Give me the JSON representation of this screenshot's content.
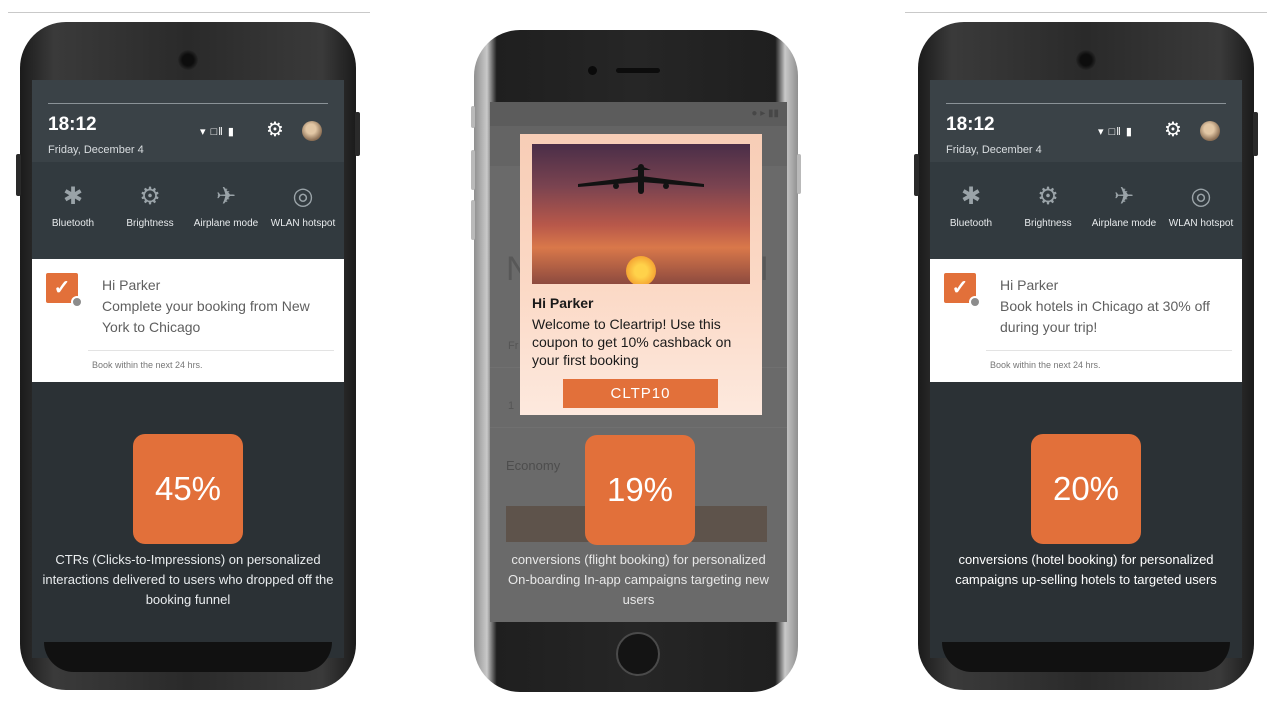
{
  "android_status": {
    "time": "18:12",
    "date": "Friday, December 4",
    "signal_text": "▾ □‖ ▮"
  },
  "quick_settings": [
    {
      "label": "Bluetooth",
      "icon": "✱"
    },
    {
      "label": "Brightness",
      "icon": "⚙"
    },
    {
      "label": "Airplane mode",
      "icon": "✈"
    },
    {
      "label": "WLAN hotspot",
      "icon": "◎"
    }
  ],
  "phones": [
    {
      "notification": {
        "title": "Hi Parker",
        "body": "Complete your booking from New York to Chicago",
        "footer": "Book within the next 24 hrs."
      },
      "stat": "45%",
      "caption": "CTRs (Clicks-to-Impressions) on personalized interactions delivered to users who dropped off the booking funnel"
    },
    {
      "coupon": {
        "title": "Hi Parker",
        "body": "Welcome to Cleartrip! Use this coupon to get 10% cashback on your first booking",
        "code": "CLTP10"
      },
      "background": {
        "letter_left": "N",
        "letter_right": "I",
        "field_left": "Fr",
        "field_one": "1",
        "cabin": "Economy"
      },
      "stat": "19%",
      "caption": "conversions (flight booking) for personalized On-boarding In-app campaigns targeting new users"
    },
    {
      "notification": {
        "title": "Hi Parker",
        "body": "Book hotels in Chicago at 30% off during your trip!",
        "footer": "Book within the next 24 hrs."
      },
      "stat": "20%",
      "caption": "conversions (hotel booking) for personalized campaigns up-selling hotels to targeted users"
    }
  ],
  "colors": {
    "accent": "#e2703a",
    "screen_dark": "#2b3135"
  }
}
